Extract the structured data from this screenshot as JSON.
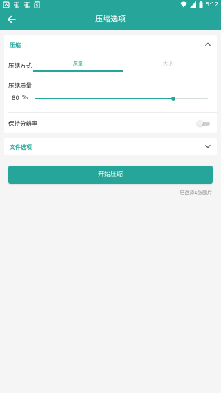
{
  "status_bar": {
    "time": "5:12",
    "left_icons": [
      "notification-icon",
      "app-icon",
      "app-icon",
      "sd-card-icon"
    ],
    "right_icons": [
      "wifi-icon",
      "signal-icon",
      "battery-icon"
    ]
  },
  "app_bar": {
    "title": "压缩选项",
    "back_icon": "arrow-left-icon"
  },
  "compression": {
    "section_title": "压缩",
    "expand_icon": "chevron-up-icon",
    "method_label": "压缩方式",
    "tabs": [
      {
        "label": "质量",
        "selected": true
      },
      {
        "label": "大小",
        "selected": false
      }
    ],
    "quality_label": "压缩质量",
    "quality_value": "80",
    "quality_unit": "%",
    "quality_percent": 80,
    "keep_resolution_label": "保持分辨率",
    "keep_resolution_enabled": false
  },
  "file_options": {
    "section_title": "文件选项",
    "expand_icon": "chevron-down-icon"
  },
  "start_button": {
    "label": "开始压缩"
  },
  "selected_info": "已选择1张图片",
  "colors": {
    "primary": "#26a69a",
    "background": "#f5f5f5",
    "inactive_tab": "#b7c9c7"
  }
}
